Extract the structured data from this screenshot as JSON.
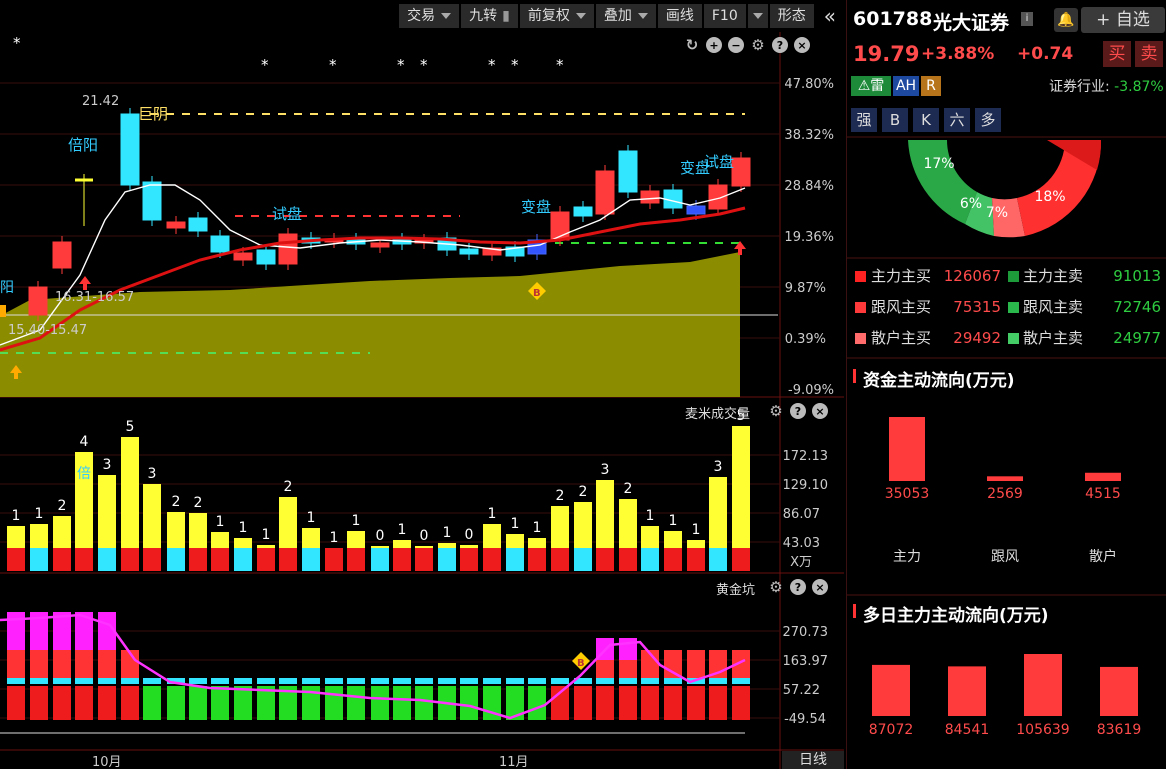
{
  "toolbar": {
    "items": [
      {
        "label": "交易",
        "dropdown": true
      },
      {
        "label": "九转",
        "lock": true
      },
      {
        "label": "前复权",
        "dropdown": true
      },
      {
        "label": "叠加",
        "dropdown": true
      },
      {
        "label": "画线",
        "dropdown": false
      },
      {
        "label": "F10",
        "dropdown": false
      },
      {
        "label": "形态",
        "dropdown": false
      }
    ],
    "collapse": "«",
    "f10_dropdown": "▾"
  },
  "main_chart": {
    "y_labels": [
      "47.80%",
      "38.32%",
      "28.84%",
      "19.36%",
      "9.87%",
      "0.39%",
      "-9.09%"
    ],
    "annotations": {
      "high": "21.42",
      "beiyang": "倍阳",
      "juyin": "巨阴",
      "shipan1": "试盘",
      "bianpan1": "变盘",
      "bianpan2": "变盘",
      "shipan2": "试盘",
      "range1": "16.31-16.57",
      "range2": "15.40-15.47",
      "left_yang": "阳"
    },
    "stars": [
      "*",
      "*",
      "*",
      "*",
      "*",
      "*",
      "*",
      "*",
      "*"
    ],
    "b_marker": "B"
  },
  "volume_panel": {
    "title": "麦米成交量",
    "y_labels": [
      "172.13",
      "129.10",
      "86.07",
      "43.03"
    ],
    "unit": "X万",
    "bar_labels": [
      "1",
      "1",
      "2",
      "4",
      "3",
      "5",
      "3",
      "2",
      "2",
      "1",
      "1",
      "1",
      "2",
      "1",
      "1",
      "1",
      "0",
      "1",
      "0",
      "1",
      "0",
      "1",
      "1",
      "1",
      "2",
      "2",
      "3",
      "2",
      "1",
      "1",
      "1",
      "3",
      "5"
    ],
    "bei": "倍"
  },
  "gold_panel": {
    "title": "黄金坑",
    "y_labels": [
      "270.73",
      "163.97",
      "57.22",
      "-49.54"
    ],
    "b_marker": "B"
  },
  "x_axis": {
    "months": [
      "10月",
      "11月"
    ],
    "period": "日线"
  },
  "stock": {
    "code": "601788",
    "name": "光大证券",
    "price": "19.79",
    "change_pct": "+3.88%",
    "change": "+0.74",
    "buy": "买",
    "sell": "卖",
    "watch": "+ 自选",
    "info": "i"
  },
  "tags": {
    "lei": "雷",
    "ah": "AH",
    "r": "R",
    "industry_label": "证券行业:",
    "industry_value": "-3.87%"
  },
  "quick_buttons": [
    "强",
    "B",
    "K",
    "六",
    "多"
  ],
  "donut": {
    "labels": [
      "17%",
      "6%",
      "7%",
      "18%"
    ]
  },
  "flow_table": [
    {
      "buy_label": "主力主买",
      "buy_value": "126067",
      "sell_label": "主力主卖",
      "sell_value": "91013"
    },
    {
      "buy_label": "跟风主买",
      "buy_value": "75315",
      "sell_label": "跟风主卖",
      "sell_value": "72746"
    },
    {
      "buy_label": "散户主买",
      "buy_value": "29492",
      "sell_label": "散户主卖",
      "sell_value": "24977"
    }
  ],
  "capital_flow": {
    "title": "资金主动流向(万元)",
    "bars": [
      {
        "label": "主力",
        "value": 35053
      },
      {
        "label": "跟风",
        "value": 2569
      },
      {
        "label": "散户",
        "value": 4515
      }
    ]
  },
  "multi_day": {
    "title": "多日主力主动流向(万元)",
    "bars": [
      87072,
      84541,
      105639,
      83619
    ]
  },
  "colors": {
    "up": "#ff3b3b",
    "down": "#33e6ff",
    "yellow": "#ffff33",
    "olive": "#8a8a00",
    "green": "#2ecc40"
  }
}
